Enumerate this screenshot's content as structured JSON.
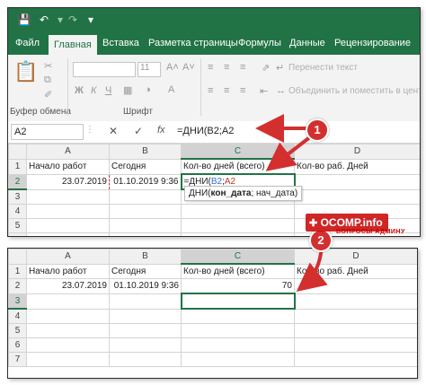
{
  "quick_access": {
    "save_icon": "save-icon",
    "undo_icon": "undo-icon",
    "redo_icon": "redo-icon",
    "customize_icon": "customize-icon"
  },
  "tabs": [
    "Файл",
    "Главная",
    "Вставка",
    "Разметка страницы",
    "Формулы",
    "Данные",
    "Рецензирование"
  ],
  "active_tab": "Главная",
  "ribbon": {
    "clipboard_label": "Буфер обмена",
    "font_label": "Шрифт",
    "font_size": "11",
    "bold": "Ж",
    "italic": "К",
    "underline": "Ч",
    "wrap_text": "Перенести текст",
    "merge_center": "Объединить и поместить в центре"
  },
  "formula_bar": {
    "name_box": "A2",
    "cancel": "✕",
    "enter": "✓",
    "fx": "fx",
    "formula": "=ДНИ(B2;A2"
  },
  "columns": [
    "A",
    "B",
    "C",
    "D"
  ],
  "sheet1": {
    "rows": [
      {
        "num": "1",
        "a": "Начало работ",
        "b": "Сегодня",
        "c": "Кол-во дней (всего)",
        "d": "Кол-во раб. Дней"
      },
      {
        "num": "2",
        "a": "23.07.2019",
        "b": "01.10.2019 9:36",
        "c_prefix": "=ДНИ(",
        "c_ref1": "B2",
        "c_sep": ";",
        "c_ref2": "A2",
        "d": ""
      },
      {
        "num": "3",
        "a": "",
        "b": "",
        "c": "",
        "d": ""
      },
      {
        "num": "4",
        "a": "",
        "b": "",
        "c": "",
        "d": ""
      },
      {
        "num": "5",
        "a": "",
        "b": "",
        "c": "",
        "d": ""
      },
      {
        "num": "6",
        "a": "",
        "b": "",
        "c": "",
        "d": ""
      }
    ],
    "tooltip_prefix": "ДНИ(",
    "tooltip_bold": "кон_дата",
    "tooltip_rest": "; нач_дата)"
  },
  "sheet2": {
    "rows": [
      {
        "num": "1",
        "a": "Начало работ",
        "b": "Сегодня",
        "c": "Кол-во дней (всего)",
        "d": "Кол-во раб. Дней"
      },
      {
        "num": "2",
        "a": "23.07.2019",
        "b": "01.10.2019 9:36",
        "c": "70",
        "d": ""
      },
      {
        "num": "3",
        "a": "",
        "b": "",
        "c": "",
        "d": ""
      },
      {
        "num": "4",
        "a": "",
        "b": "",
        "c": "",
        "d": ""
      },
      {
        "num": "5",
        "a": "",
        "b": "",
        "c": "",
        "d": ""
      },
      {
        "num": "6",
        "a": "",
        "b": "",
        "c": "",
        "d": ""
      },
      {
        "num": "7",
        "a": "",
        "b": "",
        "c": "",
        "d": ""
      }
    ]
  },
  "annotations": {
    "badge1": "1",
    "badge2": "2"
  },
  "watermark": {
    "text": "OCOMP.info",
    "sub": "ВОПРОСЫ АДМИНУ"
  },
  "colors": {
    "excel_green": "#217346",
    "arrow_red": "#d32f2f"
  }
}
